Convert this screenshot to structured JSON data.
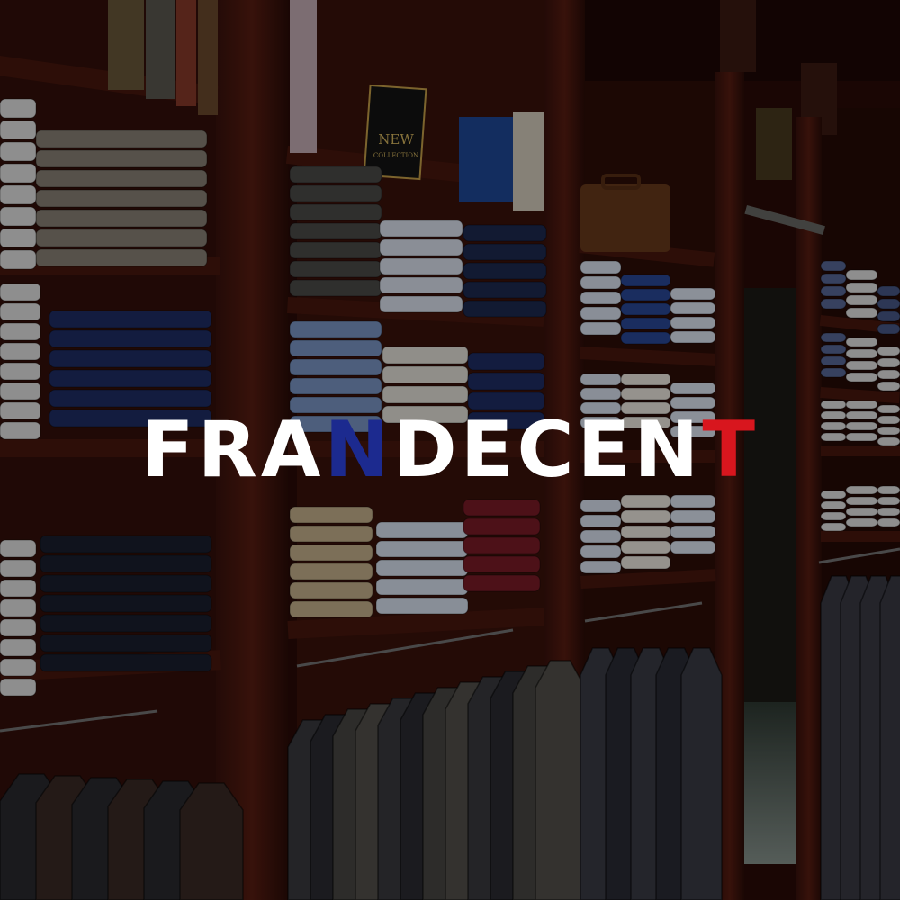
{
  "sign": {
    "line1": "NEW",
    "line2": "COLLECTION"
  },
  "logo": {
    "parts": [
      "FRA",
      "N",
      "DECEN",
      "T"
    ],
    "colors": {
      "white": "#ffffff",
      "blue": "#1c2a8f",
      "red": "#d8161e"
    }
  }
}
